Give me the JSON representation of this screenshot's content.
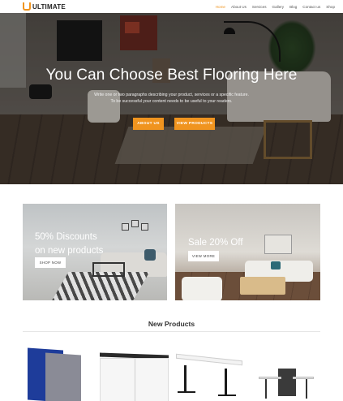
{
  "brand": {
    "name": "ULTIMATE",
    "accent": "#f0941f"
  },
  "nav": {
    "items": [
      {
        "label": "Home",
        "active": true
      },
      {
        "label": "About Us",
        "active": false
      },
      {
        "label": "Services",
        "active": false
      },
      {
        "label": "Gallery",
        "active": false
      },
      {
        "label": "Blog",
        "active": false
      },
      {
        "label": "Contact us",
        "active": false
      },
      {
        "label": "Shop",
        "active": false
      }
    ]
  },
  "hero": {
    "title": "You Can Choose Best Flooring Here",
    "subtitle_line1": "Write one or two paragraphs describing your product, services or a specific feature.",
    "subtitle_line2": "To be successful your content needs to be useful to your readers.",
    "button_about": "ABOUT US",
    "button_products": "VIEW PRODUCTS"
  },
  "promos": [
    {
      "title_line1": "50% Discounts",
      "title_line2": "on new products",
      "button": "SHOP NOW"
    },
    {
      "title_line1": "Sale 20% Off",
      "title_line2": "",
      "button": "VIEW MORE"
    }
  ],
  "new_products": {
    "title": "New Products",
    "items": [
      {
        "icon": "acoustic-panel-icon"
      },
      {
        "icon": "cabinet-icon"
      },
      {
        "icon": "standing-desk-icon"
      },
      {
        "icon": "workstation-icon"
      }
    ]
  }
}
